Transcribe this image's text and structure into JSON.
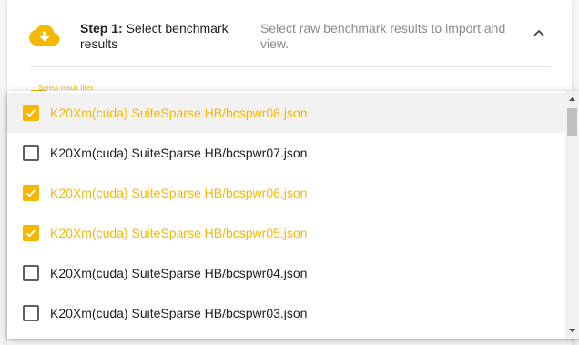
{
  "step": {
    "number_label": "Step 1:",
    "title": "Select benchmark results",
    "description": "Select raw benchmark results to import and view.",
    "icon": "cloud-download-icon",
    "accent_color": "#f5b800"
  },
  "field": {
    "label": "Select result files"
  },
  "options": [
    {
      "label": "K20Xm(cuda) SuiteSparse HB/bcspwr08.json",
      "checked": true
    },
    {
      "label": "K20Xm(cuda) SuiteSparse HB/bcspwr07.json",
      "checked": false
    },
    {
      "label": "K20Xm(cuda) SuiteSparse HB/bcspwr06.json",
      "checked": true
    },
    {
      "label": "K20Xm(cuda) SuiteSparse HB/bcspwr05.json",
      "checked": true
    },
    {
      "label": "K20Xm(cuda) SuiteSparse HB/bcspwr04.json",
      "checked": false
    },
    {
      "label": "K20Xm(cuda) SuiteSparse HB/bcspwr03.json",
      "checked": false
    }
  ]
}
